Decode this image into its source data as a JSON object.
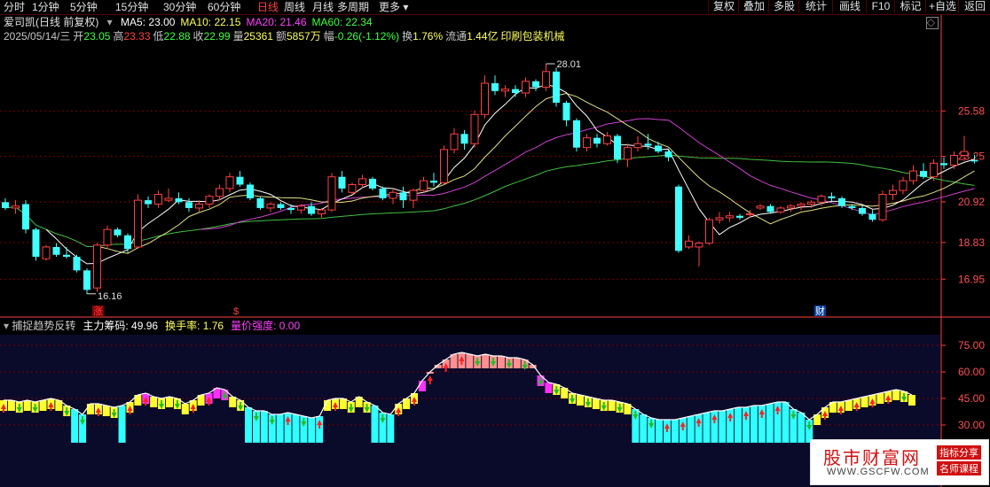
{
  "toolbar": {
    "tabs": [
      "分时",
      "1分钟",
      "5分钟",
      "15分钟",
      "30分钟",
      "60分钟",
      "日线",
      "周线",
      "月线",
      "多周期",
      "更多"
    ],
    "active": "日线",
    "right_buttons": [
      "复权",
      "叠加",
      "多股",
      "统计",
      "画线",
      "F10",
      "标记",
      "+自选",
      "返回"
    ]
  },
  "header": {
    "stock": "爱司凯(日线 前复权)",
    "ma": [
      {
        "label": "MA5: 23.00",
        "color": "#ffffff"
      },
      {
        "label": "MA10: 22.15",
        "color": "#ffff60"
      },
      {
        "label": "MA20: 21.46",
        "color": "#ff40ff"
      },
      {
        "label": "MA60: 22.34",
        "color": "#40ff40"
      }
    ],
    "info": [
      {
        "t": "2025/05/14/三",
        "c": "#c8c8c8"
      },
      {
        "t": "开",
        "c": "#c8c8c8"
      },
      {
        "t": "23.05",
        "c": "#40ff40"
      },
      {
        "t": "高",
        "c": "#c8c8c8"
      },
      {
        "t": "23.33",
        "c": "#ff4040"
      },
      {
        "t": "低",
        "c": "#c8c8c8"
      },
      {
        "t": "22.88",
        "c": "#40ff40"
      },
      {
        "t": "收",
        "c": "#c8c8c8"
      },
      {
        "t": "22.99",
        "c": "#40ff40"
      },
      {
        "t": "量",
        "c": "#c8c8c8"
      },
      {
        "t": "25361",
        "c": "#ffff60"
      },
      {
        "t": "额",
        "c": "#c8c8c8"
      },
      {
        "t": "5857万",
        "c": "#ffff60"
      },
      {
        "t": "幅",
        "c": "#c8c8c8"
      },
      {
        "t": "-0.26(-1.12%)",
        "c": "#40ff40"
      },
      {
        "t": "换",
        "c": "#c8c8c8"
      },
      {
        "t": "1.76%",
        "c": "#ffff60"
      },
      {
        "t": "流通",
        "c": "#c8c8c8"
      },
      {
        "t": "1.44亿",
        "c": "#ffff60"
      },
      {
        "t": "印刷包装机械",
        "c": "#ffff60"
      }
    ]
  },
  "indicator_header": [
    {
      "t": "捕捉趋势反转",
      "c": "#c8c8c8"
    },
    {
      "t": "主力筹码: 49.96",
      "c": "#ffffff"
    },
    {
      "t": "换手率: 1.76",
      "c": "#ffff60"
    },
    {
      "t": "量价强度: 0.00",
      "c": "#ff40ff"
    }
  ],
  "watermark": {
    "main": "股市财富网",
    "tag1": "指标分享",
    "tag2": "名师课程",
    "url": "WWW.GSCFW.COM"
  },
  "colors": {
    "up": "#ff4040",
    "down": "#40ffff",
    "grid": "#800000",
    "axis": "#ff4040",
    "bg_lower": "#0a0a2a"
  },
  "chart_data": [
    {
      "type": "candlestick",
      "y_ticks": [
        "25.58",
        "23.25",
        "20.92",
        "18.83",
        "16.95"
      ],
      "annotations": {
        "high": "28.01",
        "low": "16.16",
        "markers": [
          "涨",
          "$",
          "财"
        ]
      },
      "series": [
        {
          "name": "MA5"
        },
        {
          "name": "MA10"
        },
        {
          "name": "MA20"
        },
        {
          "name": "MA60"
        }
      ],
      "candles": [
        [
          20.9,
          21.1,
          20.5,
          20.6
        ],
        [
          20.6,
          21.0,
          20.3,
          20.7
        ],
        [
          20.8,
          21.0,
          19.3,
          19.5
        ],
        [
          19.5,
          19.6,
          17.9,
          18.1
        ],
        [
          18.0,
          18.7,
          17.9,
          18.6
        ],
        [
          18.6,
          18.8,
          18.1,
          18.2
        ],
        [
          18.2,
          18.6,
          18.0,
          18.1
        ],
        [
          18.1,
          18.2,
          17.3,
          17.4
        ],
        [
          17.4,
          17.5,
          16.2,
          16.4
        ],
        [
          16.5,
          18.8,
          16.3,
          18.7
        ],
        [
          18.7,
          19.7,
          18.5,
          19.5
        ],
        [
          19.5,
          19.6,
          19.1,
          19.2
        ],
        [
          19.2,
          19.3,
          18.3,
          18.5
        ],
        [
          18.6,
          21.3,
          18.5,
          21.0
        ],
        [
          21.0,
          21.2,
          20.6,
          20.8
        ],
        [
          20.8,
          21.5,
          20.6,
          21.3
        ],
        [
          21.0,
          21.6,
          20.9,
          21.1
        ],
        [
          21.1,
          21.4,
          20.8,
          20.9
        ],
        [
          20.9,
          21.1,
          20.4,
          20.6
        ],
        [
          20.6,
          21.0,
          20.4,
          20.8
        ],
        [
          20.8,
          21.3,
          20.6,
          21.2
        ],
        [
          21.2,
          21.8,
          21.0,
          21.6
        ],
        [
          21.6,
          22.4,
          21.4,
          22.2
        ],
        [
          22.2,
          22.5,
          21.7,
          21.8
        ],
        [
          21.8,
          21.9,
          21.0,
          21.1
        ],
        [
          21.1,
          21.2,
          20.5,
          20.6
        ],
        [
          20.6,
          20.9,
          20.4,
          20.8
        ],
        [
          20.8,
          20.9,
          20.5,
          20.6
        ],
        [
          20.6,
          20.8,
          20.3,
          20.5
        ],
        [
          20.5,
          20.8,
          20.3,
          20.7
        ],
        [
          20.7,
          20.9,
          20.2,
          20.3
        ],
        [
          20.3,
          20.6,
          20.1,
          20.5
        ],
        [
          20.5,
          22.4,
          20.4,
          22.2
        ],
        [
          22.2,
          22.5,
          21.4,
          21.6
        ],
        [
          21.4,
          21.9,
          21.2,
          21.8
        ],
        [
          21.8,
          22.3,
          21.6,
          22.1
        ],
        [
          22.1,
          22.2,
          21.5,
          21.6
        ],
        [
          21.6,
          21.7,
          21.0,
          21.1
        ],
        [
          21.1,
          21.6,
          20.8,
          21.4
        ],
        [
          21.4,
          21.7,
          20.6,
          21.0
        ],
        [
          21.0,
          21.6,
          20.6,
          21.5
        ],
        [
          21.5,
          22.2,
          21.4,
          22.0
        ],
        [
          22.0,
          22.4,
          21.7,
          21.9
        ],
        [
          21.9,
          23.8,
          21.8,
          23.6
        ],
        [
          23.6,
          24.7,
          23.4,
          24.4
        ],
        [
          24.4,
          24.6,
          23.6,
          23.9
        ],
        [
          23.9,
          25.6,
          23.7,
          25.4
        ],
        [
          25.4,
          27.4,
          25.2,
          27.0
        ],
        [
          27.0,
          27.4,
          26.4,
          26.6
        ],
        [
          26.6,
          26.9,
          26.3,
          26.7
        ],
        [
          26.7,
          26.9,
          26.3,
          26.5
        ],
        [
          26.5,
          27.3,
          26.3,
          27.1
        ],
        [
          27.1,
          27.2,
          26.6,
          26.8
        ],
        [
          26.8,
          28.0,
          26.6,
          27.6
        ],
        [
          27.6,
          27.8,
          25.8,
          26.0
        ],
        [
          26.0,
          26.1,
          24.8,
          25.1
        ],
        [
          25.1,
          25.2,
          23.5,
          23.7
        ],
        [
          23.7,
          24.4,
          23.5,
          24.2
        ],
        [
          24.2,
          24.4,
          23.7,
          23.9
        ],
        [
          23.9,
          24.5,
          23.8,
          24.3
        ],
        [
          24.3,
          24.4,
          22.9,
          23.1
        ],
        [
          23.1,
          23.9,
          22.7,
          23.7
        ],
        [
          23.7,
          24.3,
          23.5,
          23.9
        ],
        [
          23.9,
          24.4,
          23.6,
          23.8
        ],
        [
          23.8,
          24.0,
          23.4,
          23.5
        ],
        [
          23.5,
          23.6,
          23.0,
          23.2
        ],
        [
          21.7,
          21.8,
          18.3,
          18.4
        ],
        [
          18.6,
          19.2,
          18.5,
          18.9
        ],
        [
          18.6,
          18.9,
          17.6,
          18.8
        ],
        [
          18.8,
          20.1,
          18.7,
          20.0
        ],
        [
          20.0,
          20.4,
          19.8,
          20.1
        ],
        [
          20.1,
          20.4,
          19.9,
          20.2
        ],
        [
          20.2,
          20.3,
          20.0,
          20.1
        ],
        [
          20.3,
          20.5,
          20.1,
          20.3
        ],
        [
          20.6,
          20.8,
          20.5,
          20.7
        ],
        [
          20.7,
          20.8,
          20.3,
          20.4
        ],
        [
          20.4,
          20.7,
          20.3,
          20.6
        ],
        [
          20.6,
          20.8,
          20.4,
          20.7
        ],
        [
          20.7,
          20.9,
          20.5,
          20.8
        ],
        [
          20.8,
          21.0,
          20.6,
          20.9
        ],
        [
          20.9,
          21.3,
          20.7,
          21.2
        ],
        [
          21.2,
          21.4,
          20.9,
          21.1
        ],
        [
          21.1,
          21.2,
          20.6,
          20.7
        ],
        [
          20.7,
          20.8,
          20.5,
          20.6
        ],
        [
          20.6,
          20.7,
          20.2,
          20.3
        ],
        [
          20.3,
          20.5,
          19.9,
          20.0
        ],
        [
          20.0,
          21.5,
          19.9,
          21.3
        ],
        [
          21.3,
          21.8,
          21.0,
          21.5
        ],
        [
          21.5,
          22.2,
          21.3,
          22.0
        ],
        [
          22.0,
          22.8,
          21.8,
          22.5
        ],
        [
          22.5,
          22.9,
          22.1,
          22.2
        ],
        [
          22.2,
          23.1,
          22.0,
          22.9
        ],
        [
          22.9,
          23.2,
          22.6,
          22.8
        ],
        [
          22.8,
          23.5,
          22.6,
          23.3
        ],
        [
          23.3,
          24.3,
          23.0,
          23.5
        ],
        [
          23.05,
          23.33,
          22.88,
          22.99
        ]
      ]
    },
    {
      "type": "bar",
      "y_ticks": [
        "75.00",
        "60.00",
        "45.00",
        "30.00"
      ],
      "ylim": [
        20,
        80
      ],
      "values": [
        44,
        44,
        43,
        44,
        43,
        44,
        45,
        44,
        41,
        39,
        36,
        42,
        42,
        41,
        40,
        41,
        43,
        47,
        48,
        46,
        45,
        46,
        45,
        42,
        44,
        47,
        48,
        51,
        50,
        46,
        44,
        40,
        38,
        38,
        36,
        36,
        37,
        36,
        35,
        34,
        35,
        44,
        45,
        45,
        43,
        46,
        43,
        41,
        37,
        36,
        42,
        45,
        48,
        55,
        60,
        64,
        67,
        70,
        71,
        70,
        69,
        70,
        69,
        69,
        68,
        68,
        67,
        64,
        58,
        54,
        53,
        51,
        48,
        47,
        46,
        45,
        44,
        44,
        43,
        42,
        39,
        36,
        34,
        33,
        33,
        33,
        34,
        35,
        36,
        37,
        38,
        38,
        39,
        40,
        40,
        41,
        41,
        42,
        43,
        43,
        39,
        37,
        33,
        36,
        40,
        43,
        43,
        44,
        45,
        46,
        47,
        48,
        49,
        50,
        49,
        47
      ],
      "colors": [
        "Y",
        "Y",
        "Y",
        "Y",
        "Y",
        "Y",
        "Y",
        "Y",
        "Y",
        "C",
        "C",
        "Y",
        "Y",
        "Y",
        "Y",
        "C",
        "Y",
        "Y",
        "M",
        "Y",
        "Y",
        "Y",
        "Y",
        "Y",
        "Y",
        "Y",
        "M",
        "M",
        "M",
        "Y",
        "Y",
        "C",
        "C",
        "C",
        "C",
        "C",
        "C",
        "C",
        "C",
        "C",
        "C",
        "Y",
        "Y",
        "Y",
        "Y",
        "Y",
        "Y",
        "C",
        "C",
        "C",
        "Y",
        "Y",
        "Y",
        "M",
        "R",
        "R",
        "R",
        "R",
        "R",
        "R",
        "R",
        "R",
        "R",
        "R",
        "R",
        "R",
        "R",
        "R",
        "M",
        "M",
        "Y",
        "Y",
        "Y",
        "Y",
        "Y",
        "Y",
        "Y",
        "Y",
        "Y",
        "Y",
        "C",
        "C",
        "C",
        "C",
        "C",
        "C",
        "C",
        "C",
        "C",
        "C",
        "C",
        "C",
        "C",
        "C",
        "C",
        "C",
        "C",
        "C",
        "C",
        "C",
        "C",
        "C",
        "C",
        "Y",
        "Y",
        "Y",
        "Y",
        "Y",
        "Y",
        "Y",
        "Y",
        "Y",
        "Y",
        "Y",
        "Y",
        "Y"
      ]
    }
  ]
}
